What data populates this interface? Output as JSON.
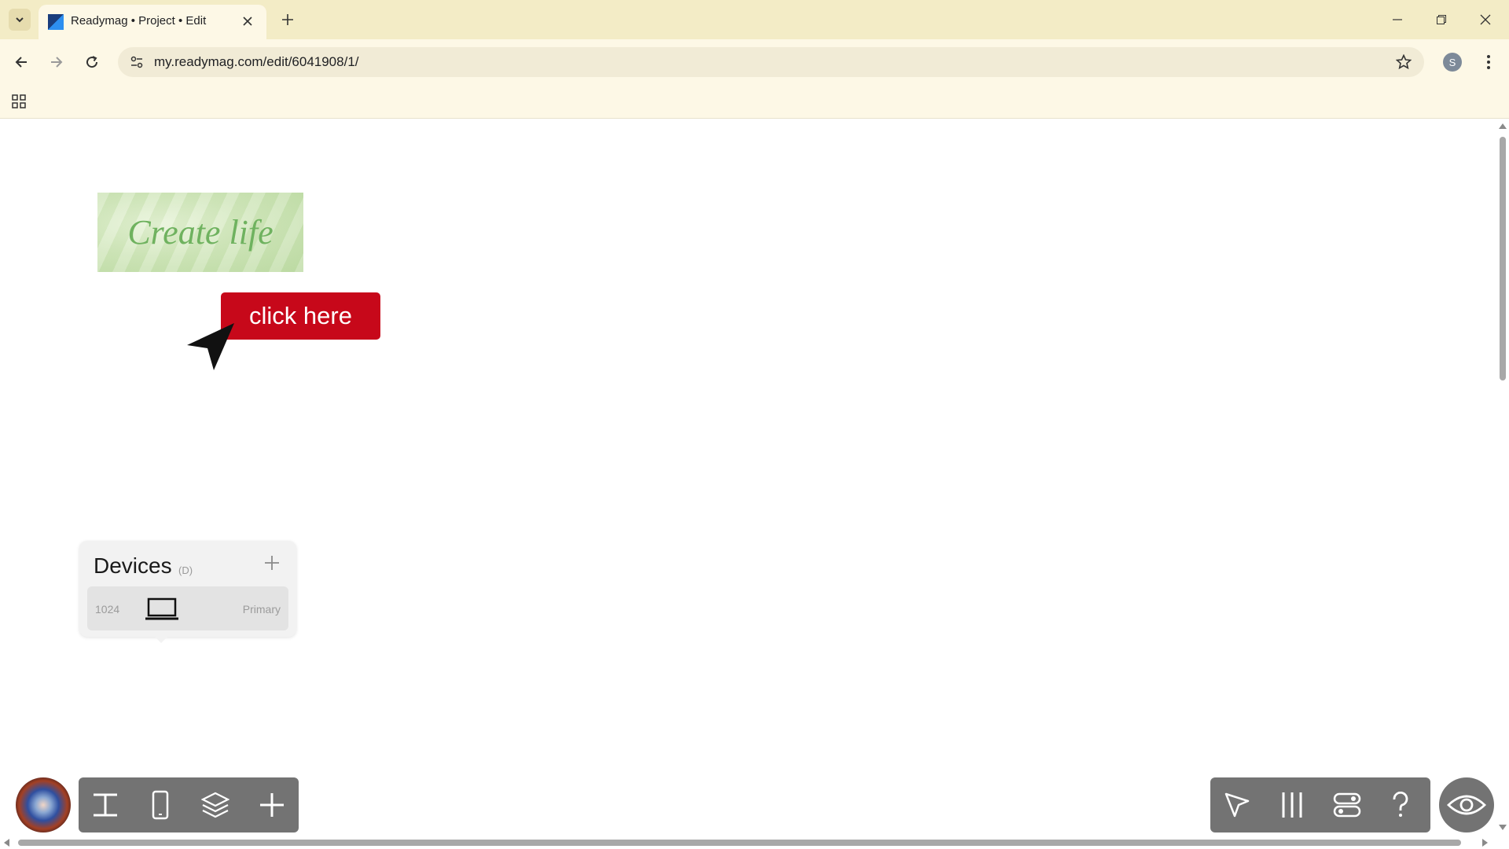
{
  "browser": {
    "tab_title": "Readymag • Project • Edit",
    "url": "my.readymag.com/edit/6041908/1/",
    "profile_initial": "S"
  },
  "canvas": {
    "banner_text": "Create life",
    "button_label": "click here",
    "button_color": "#c7081a"
  },
  "devices_panel": {
    "title": "Devices",
    "shortcut": "(D)",
    "device": {
      "width": "1024",
      "label": "Primary",
      "icon": "laptop-icon"
    }
  },
  "toolbar_left": [
    "text-tool-icon",
    "mobile-icon",
    "layers-icon",
    "plus-icon"
  ],
  "toolbar_right": [
    "pointer-icon",
    "columns-icon",
    "toggle-settings-icon",
    "help-icon"
  ],
  "preview": {
    "icon": "eye-icon"
  }
}
